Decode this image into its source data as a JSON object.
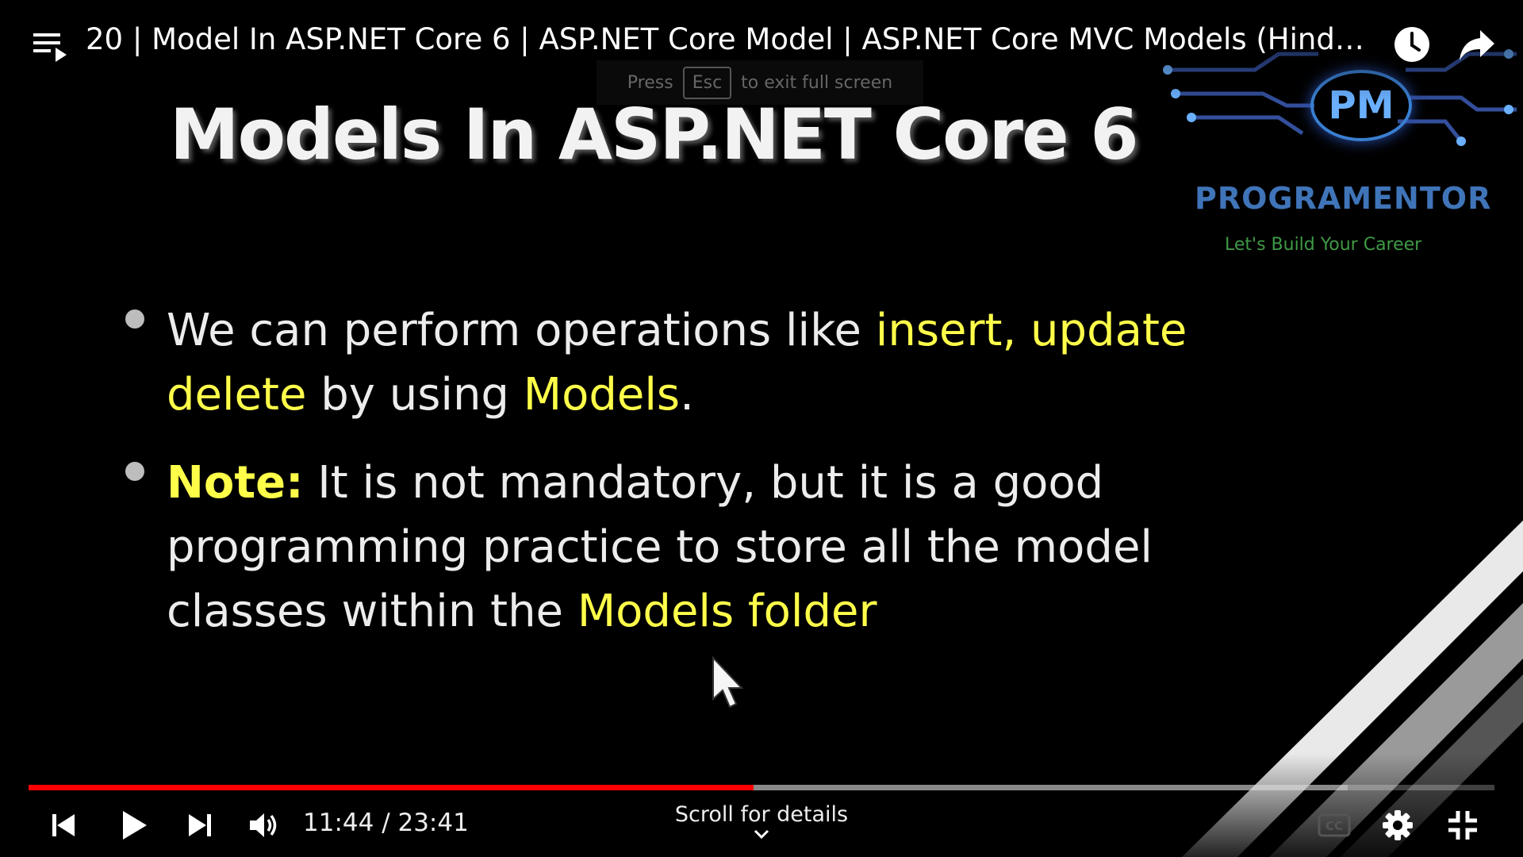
{
  "player": {
    "video_title": "20 | Model In ASP.NET Core 6 | ASP.NET Core Model | ASP.NET Core MVC Models (Hindi/…",
    "esc_hint": {
      "press": "Press",
      "key": "Esc",
      "rest": "to exit full screen"
    },
    "time_display": "11:44 / 23:41",
    "scroll_details": "Scroll for details",
    "progress_fraction": 0.4945,
    "buffered_fraction": 0.9,
    "accent_color": "#ff0000",
    "icons": {
      "playlist": "playlist-icon",
      "watch_later": "clock-icon",
      "share": "share-icon",
      "previous": "previous-icon",
      "play": "play-icon",
      "next": "next-icon",
      "volume": "volume-icon",
      "captions": "captions-icon",
      "settings": "gear-icon",
      "exit_fullscreen": "exit-fullscreen-icon",
      "details": "chevron-down-icon"
    }
  },
  "slide": {
    "title": "Models In ASP.NET Core 6",
    "highlight_color": "#ffff4a",
    "bullet1": {
      "t1": "We can perform operations like ",
      "h1": "insert, update delete",
      "t2": " by using ",
      "h2": "Models",
      "t3": "."
    },
    "bullet2": {
      "h1": "Note:",
      "t1": " It is not mandatory, but it is a good programming practice to store all the model classes within the ",
      "h2": "Models folder"
    }
  },
  "logo": {
    "monogram": "PM",
    "name": "PROGRAMENTOR",
    "tagline": "Let's Build Your Career",
    "name_color": "#3f74b8",
    "tagline_color": "#3f9a46"
  }
}
